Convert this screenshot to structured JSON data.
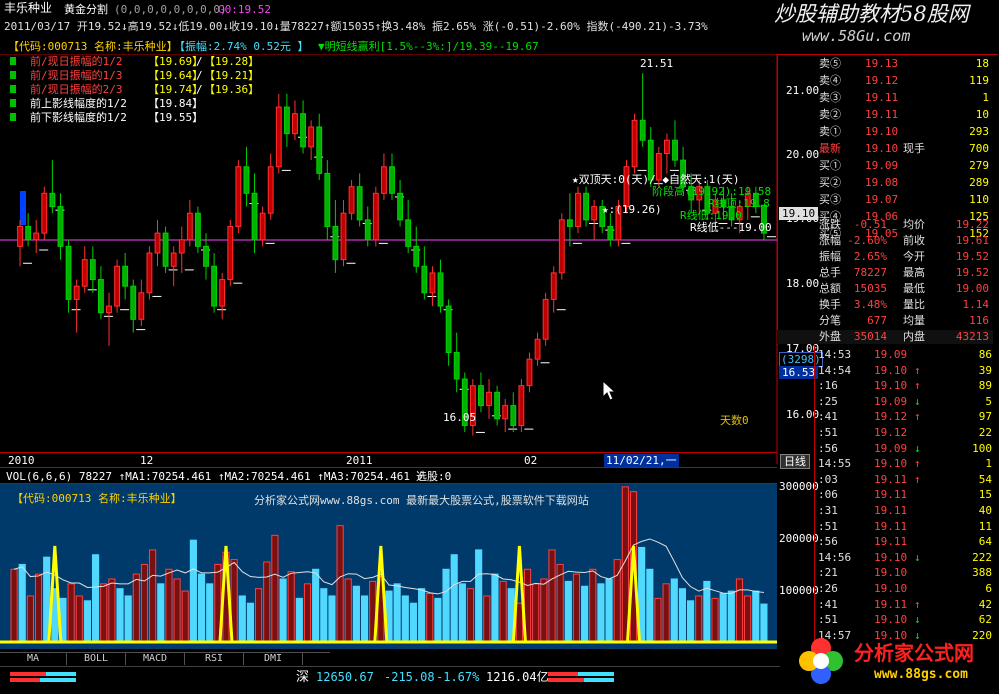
{
  "header": {
    "stock_name": "丰乐种业",
    "indicator_title": "黄金分割",
    "indicator_params": "(0,0,0,0,0,0,0,0)",
    "indicator_value": "G0:19.52",
    "quote_line": "2011/03/17 开19.52↓高19.52↓低19.00↓收19.10↓量78227↑额15035↑换3.48% 振2.65% 涨(-0.51)-2.60% 指数(-490.21)-3.73%",
    "code_line": "【代码:000713 名称:丰乐种业】",
    "amplitude_line": "【振幅:2.74% 0.52元 】",
    "trend_line": "▼明短线赢利[1.5%--3%:]/19.39--19.67"
  },
  "watermark": {
    "title": "炒股辅助教材58股网",
    "url": "www.58Gu.com"
  },
  "legend": [
    {
      "label": "前/现日振幅的1/2",
      "a": "【19.69】",
      "b": "【19.28】"
    },
    {
      "label": "前/现日振幅的1/3",
      "a": "【19.64】",
      "b": "【19.21】"
    },
    {
      "label": "前/现日振幅的2/3",
      "a": "【19.74】",
      "b": "【19.36】"
    },
    {
      "label": "前上影线幅度的1/2",
      "a": "【19.84】",
      "b": ""
    },
    {
      "label": "前下影线幅度的1/2",
      "a": "【19.55】",
      "b": ""
    }
  ],
  "chart": {
    "max_label": "21.51",
    "min_label": "16.05",
    "days_label": "天数0",
    "y_ticks": [
      "21.00",
      "20.00",
      "19.00",
      "18.00",
      "17.00",
      "16.00"
    ],
    "current_price_tag": "19.10",
    "side_count": "(3298)",
    "side_price": "16.53",
    "x_labels": [
      "2010",
      "12",
      "2011",
      "02"
    ],
    "cursor_date": "11/02/21,一",
    "period_button": "日线",
    "annotations": [
      "★双顶天:0(天)/ ◆自然天:1(天)",
      "阶段高(19.92):19.58",
      "★:(19.26)",
      "R线顶:19.8",
      "R线低:19.0",
      "R线低---19.00"
    ]
  },
  "volume": {
    "header": "VOL(6,6,6) 78227 ↑MA1:70254.461 ↑MA2:70254.461 ↑MA3:70254.461 ↑",
    "select_label": "选股:0",
    "code_line": "【代码:000713 名称:丰乐种业】",
    "ad_line": "分析家公式网www.88gs.com 最新最大股票公式,股票软件下载网站",
    "y_ticks": [
      "300000",
      "200000",
      "100000"
    ]
  },
  "chart_data": {
    "type": "candlestick",
    "title": "",
    "ylim": [
      15.8,
      21.8
    ],
    "candles": [
      [
        18.9,
        19.3,
        18.6,
        19.2
      ],
      [
        19.2,
        19.4,
        18.9,
        19.0
      ],
      [
        19.0,
        19.3,
        18.8,
        19.1
      ],
      [
        19.1,
        19.8,
        19.0,
        19.7
      ],
      [
        19.7,
        20.2,
        19.4,
        19.5
      ],
      [
        19.5,
        19.7,
        18.7,
        18.9
      ],
      [
        18.9,
        19.0,
        17.9,
        18.1
      ],
      [
        18.1,
        18.4,
        17.6,
        18.3
      ],
      [
        18.3,
        18.9,
        18.2,
        18.7
      ],
      [
        18.7,
        18.9,
        18.2,
        18.4
      ],
      [
        18.4,
        18.6,
        17.8,
        17.9
      ],
      [
        17.9,
        18.2,
        17.4,
        18.0
      ],
      [
        18.0,
        18.7,
        17.9,
        18.6
      ],
      [
        18.6,
        18.8,
        18.1,
        18.3
      ],
      [
        18.3,
        18.4,
        17.6,
        17.8
      ],
      [
        17.8,
        18.4,
        17.7,
        18.2
      ],
      [
        18.2,
        18.9,
        18.1,
        18.8
      ],
      [
        18.8,
        19.3,
        18.6,
        19.1
      ],
      [
        19.1,
        19.2,
        18.5,
        18.6
      ],
      [
        18.6,
        18.9,
        18.3,
        18.8
      ],
      [
        18.8,
        19.2,
        18.5,
        19.0
      ],
      [
        19.0,
        19.6,
        18.9,
        19.4
      ],
      [
        19.4,
        19.5,
        18.8,
        18.9
      ],
      [
        18.9,
        19.1,
        18.4,
        18.6
      ],
      [
        18.6,
        18.8,
        17.9,
        18.0
      ],
      [
        18.0,
        18.5,
        17.8,
        18.4
      ],
      [
        18.4,
        19.3,
        18.3,
        19.2
      ],
      [
        19.2,
        20.2,
        19.1,
        20.1
      ],
      [
        20.1,
        20.4,
        19.5,
        19.7
      ],
      [
        19.7,
        20.0,
        18.8,
        19.0
      ],
      [
        19.0,
        19.5,
        18.9,
        19.4
      ],
      [
        19.4,
        20.3,
        19.3,
        20.1
      ],
      [
        20.1,
        21.2,
        20.0,
        21.0
      ],
      [
        21.0,
        21.2,
        20.4,
        20.6
      ],
      [
        20.6,
        21.1,
        20.5,
        20.9
      ],
      [
        20.9,
        21.1,
        20.3,
        20.4
      ],
      [
        20.4,
        20.8,
        20.2,
        20.7
      ],
      [
        20.7,
        20.9,
        19.9,
        20.0
      ],
      [
        20.0,
        20.2,
        19.0,
        19.2
      ],
      [
        19.2,
        19.6,
        18.5,
        18.7
      ],
      [
        18.7,
        19.6,
        18.6,
        19.4
      ],
      [
        19.4,
        19.9,
        19.3,
        19.8
      ],
      [
        19.8,
        20.0,
        19.2,
        19.3
      ],
      [
        19.3,
        19.5,
        18.9,
        19.0
      ],
      [
        19.0,
        19.8,
        18.9,
        19.7
      ],
      [
        19.7,
        20.3,
        19.6,
        20.1
      ],
      [
        20.1,
        20.3,
        19.6,
        19.7
      ],
      [
        19.7,
        19.9,
        19.2,
        19.3
      ],
      [
        19.3,
        19.6,
        18.8,
        18.9
      ],
      [
        18.9,
        19.2,
        18.5,
        18.6
      ],
      [
        18.6,
        18.9,
        18.1,
        18.2
      ],
      [
        18.2,
        18.6,
        18.0,
        18.5
      ],
      [
        18.5,
        18.7,
        17.9,
        18.0
      ],
      [
        18.0,
        18.1,
        17.1,
        17.3
      ],
      [
        17.3,
        17.6,
        16.7,
        16.9
      ],
      [
        16.9,
        17.0,
        16.1,
        16.2
      ],
      [
        16.2,
        16.9,
        16.05,
        16.8
      ],
      [
        16.8,
        17.0,
        16.4,
        16.5
      ],
      [
        16.5,
        16.9,
        16.3,
        16.7
      ],
      [
        16.7,
        16.8,
        16.2,
        16.3
      ],
      [
        16.3,
        16.6,
        16.1,
        16.5
      ],
      [
        16.5,
        16.7,
        16.1,
        16.2
      ],
      [
        16.2,
        16.9,
        16.1,
        16.8
      ],
      [
        16.8,
        17.3,
        16.7,
        17.2
      ],
      [
        17.2,
        17.6,
        17.1,
        17.5
      ],
      [
        17.5,
        18.2,
        17.4,
        18.1
      ],
      [
        18.1,
        18.6,
        17.9,
        18.5
      ],
      [
        18.5,
        19.4,
        18.4,
        19.3
      ],
      [
        19.3,
        19.7,
        18.9,
        19.2
      ],
      [
        19.2,
        19.8,
        19.1,
        19.7
      ],
      [
        19.7,
        19.8,
        19.2,
        19.3
      ],
      [
        19.3,
        19.6,
        19.0,
        19.5
      ],
      [
        19.5,
        19.6,
        19.1,
        19.2
      ],
      [
        19.2,
        19.4,
        18.9,
        19.0
      ],
      [
        19.0,
        19.6,
        18.9,
        19.5
      ],
      [
        19.5,
        20.2,
        19.4,
        20.1
      ],
      [
        20.1,
        20.9,
        20.0,
        20.8
      ],
      [
        20.8,
        21.51,
        20.4,
        20.5
      ],
      [
        20.5,
        20.7,
        19.8,
        19.9
      ],
      [
        19.9,
        20.4,
        19.8,
        20.3
      ],
      [
        20.3,
        20.6,
        20.0,
        20.5
      ],
      [
        20.5,
        20.8,
        20.1,
        20.2
      ],
      [
        20.2,
        20.4,
        19.7,
        19.8
      ],
      [
        19.8,
        20.0,
        19.4,
        19.6
      ],
      [
        19.6,
        19.9,
        19.4,
        19.8
      ],
      [
        19.8,
        19.9,
        19.3,
        19.4
      ],
      [
        19.4,
        19.7,
        19.2,
        19.6
      ],
      [
        19.6,
        19.8,
        19.3,
        19.5
      ],
      [
        19.5,
        19.7,
        19.2,
        19.3
      ],
      [
        19.3,
        19.6,
        19.1,
        19.5
      ],
      [
        19.5,
        19.8,
        19.3,
        19.7
      ],
      [
        19.7,
        19.8,
        19.4,
        19.5
      ],
      [
        19.52,
        19.52,
        19.0,
        19.1
      ]
    ],
    "volumes": [
      150,
      160,
      95,
      140,
      175,
      110,
      90,
      120,
      95,
      85,
      180,
      120,
      130,
      110,
      95,
      140,
      160,
      190,
      120,
      150,
      130,
      105,
      210,
      140,
      120,
      160,
      185,
      170,
      95,
      80,
      110,
      165,
      220,
      130,
      145,
      90,
      120,
      150,
      110,
      95,
      240,
      130,
      115,
      95,
      125,
      135,
      105,
      120,
      95,
      80,
      110,
      100,
      90,
      150,
      180,
      120,
      110,
      190,
      95,
      140,
      125,
      110,
      80,
      150,
      120,
      130,
      190,
      160,
      125,
      140,
      115,
      150,
      120,
      130,
      170,
      320,
      310,
      195,
      150,
      90,
      120,
      130,
      110,
      85,
      95,
      125,
      90,
      100,
      105,
      130,
      95,
      105,
      78.227
    ],
    "volume_unit": "thousand shares"
  },
  "order_book": {
    "asks": [
      {
        "label": "卖⑤",
        "price": "19.13",
        "vol": "18"
      },
      {
        "label": "卖④",
        "price": "19.12",
        "vol": "119"
      },
      {
        "label": "卖③",
        "price": "19.11",
        "vol": "1"
      },
      {
        "label": "卖②",
        "price": "19.11",
        "vol": "10"
      },
      {
        "label": "卖①",
        "price": "19.10",
        "vol": "293"
      }
    ],
    "latest": {
      "label": "最新",
      "price": "19.10",
      "label2": "现手",
      "vol": "700"
    },
    "bids": [
      {
        "label": "买①",
        "price": "19.09",
        "vol": "279"
      },
      {
        "label": "买②",
        "price": "19.08",
        "vol": "289"
      },
      {
        "label": "买③",
        "price": "19.07",
        "vol": "110"
      },
      {
        "label": "买④",
        "price": "19.06",
        "vol": "125"
      },
      {
        "label": "买⑤",
        "price": "19.05",
        "vol": "152"
      }
    ],
    "stats": [
      {
        "l1": "涨跌",
        "v1": "-0.51",
        "l2": "均价",
        "v2": "19.22"
      },
      {
        "l1": "涨幅",
        "v1": "-2.60%",
        "l2": "前收",
        "v2": "19.61"
      },
      {
        "l1": "振幅",
        "v1": "2.65%",
        "l2": "今开",
        "v2": "19.52"
      },
      {
        "l1": "总手",
        "v1": "78227",
        "l2": "最高",
        "v2": "19.52"
      },
      {
        "l1": "总额",
        "v1": "15035",
        "l2": "最低",
        "v2": "19.00"
      },
      {
        "l1": "换手",
        "v1": "3.48%",
        "l2": "量比",
        "v2": "1.14"
      },
      {
        "l1": "分笔",
        "v1": "677",
        "l2": "均量",
        "v2": "116"
      },
      {
        "l1": "外盘",
        "v1": "35014",
        "l2": "内盘",
        "v2": "43213"
      }
    ]
  },
  "ticks": [
    {
      "time": "14:53",
      "price": "19.09",
      "dir": "",
      "vol": "86"
    },
    {
      "time": "14:54",
      "price": "19.10",
      "dir": "↑",
      "vol": "39"
    },
    {
      "time": ":16",
      "price": "19.10",
      "dir": "↑",
      "vol": "89"
    },
    {
      "time": ":25",
      "price": "19.09",
      "dir": "↓",
      "vol": "5"
    },
    {
      "time": ":41",
      "price": "19.12",
      "dir": "↑",
      "vol": "97"
    },
    {
      "time": ":51",
      "price": "19.12",
      "dir": "",
      "vol": "22"
    },
    {
      "time": ":56",
      "price": "19.09",
      "dir": "↓",
      "vol": "100"
    },
    {
      "time": "14:55",
      "price": "19.10",
      "dir": "↑",
      "vol": "1"
    },
    {
      "time": ":03",
      "price": "19.11",
      "dir": "↑",
      "vol": "54"
    },
    {
      "time": ":06",
      "price": "19.11",
      "dir": "",
      "vol": "15"
    },
    {
      "time": ":31",
      "price": "19.11",
      "dir": "",
      "vol": "40"
    },
    {
      "time": ":51",
      "price": "19.11",
      "dir": "",
      "vol": "11"
    },
    {
      "time": ":56",
      "price": "19.11",
      "dir": "",
      "vol": "64"
    },
    {
      "time": "14:56",
      "price": "19.10",
      "dir": "↓",
      "vol": "222"
    },
    {
      "time": ":21",
      "price": "19.10",
      "dir": "",
      "vol": "388"
    },
    {
      "time": ":26",
      "price": "19.10",
      "dir": "",
      "vol": "6"
    },
    {
      "time": ":41",
      "price": "19.11",
      "dir": "↑",
      "vol": "42"
    },
    {
      "time": ":51",
      "price": "19.10",
      "dir": "↓",
      "vol": "62"
    },
    {
      "time": "14:57",
      "price": "19.10",
      "dir": "↓",
      "vol": "220"
    }
  ],
  "tabs": [
    "MA",
    "BOLL",
    "MACD",
    "RSI",
    "DMI"
  ],
  "status": {
    "market": "深",
    "index": "12650.67",
    "change": "-215.08",
    "pct": "-1.67%",
    "amount": "1216.04亿"
  },
  "logo": {
    "name": "分析家公式网",
    "url": "www.88gs.com"
  }
}
